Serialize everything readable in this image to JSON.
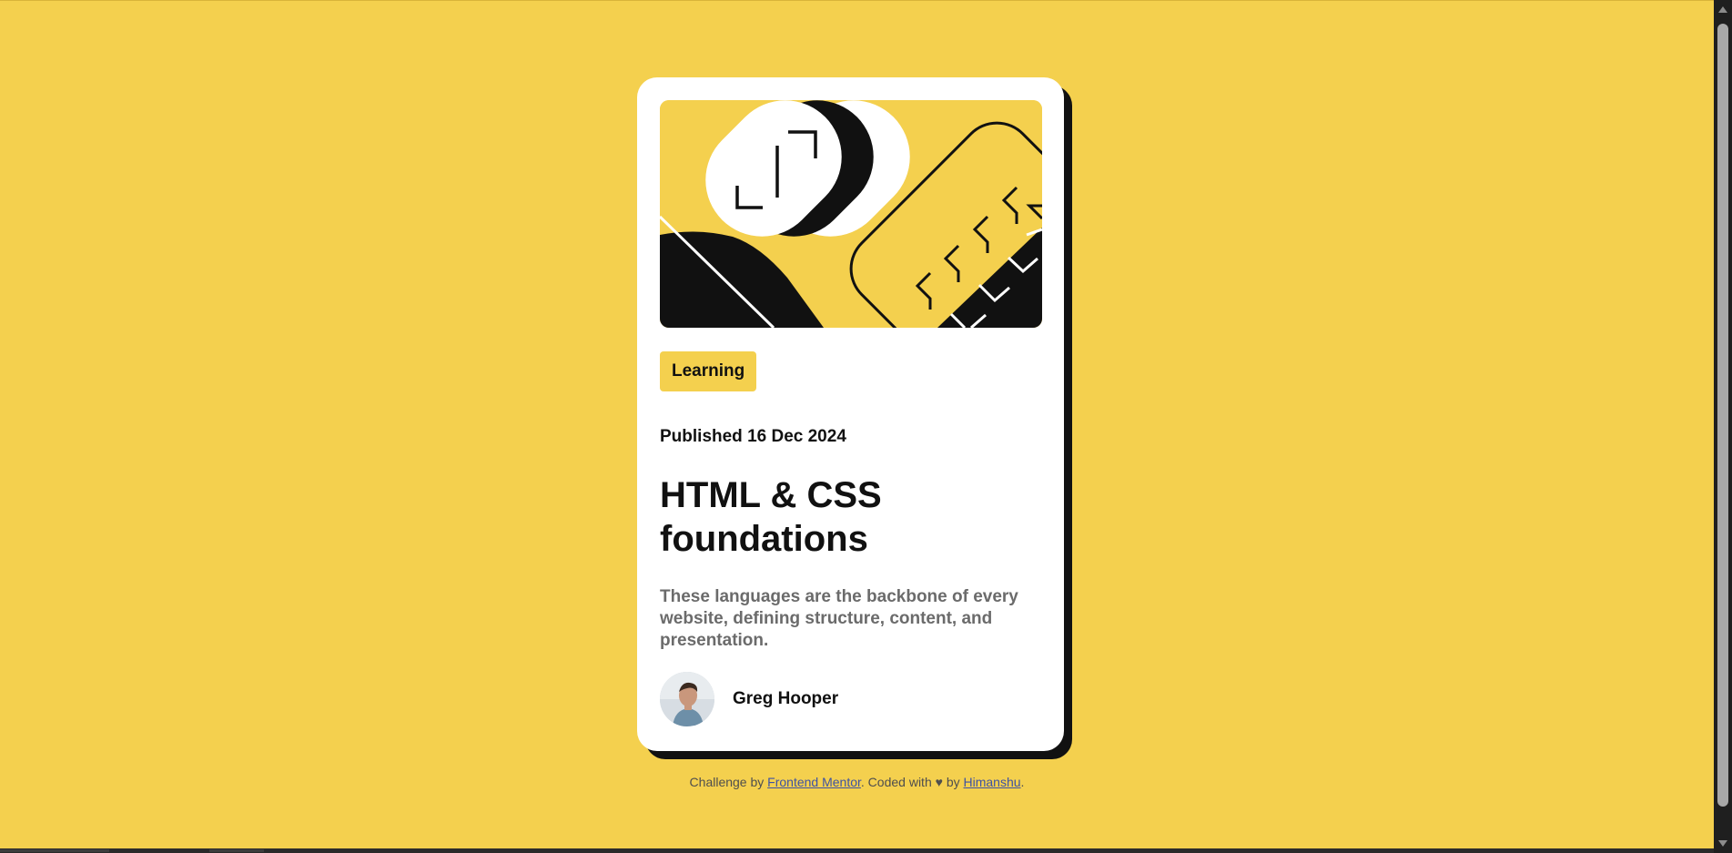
{
  "card": {
    "tag": "Learning",
    "published": "Published 16 Dec 2024",
    "title_line1": "HTML & CSS",
    "title_line2": "foundations",
    "description": "These languages are the backbone of every website, defining structure, content, and presentation.",
    "author_name": "Greg Hooper"
  },
  "footer": {
    "prefix": "Challenge by ",
    "link1": "Frontend Mentor",
    "middle": ". Coded with ",
    "heart": "♥",
    "by": " by ",
    "link2": "Himanshu",
    "suffix": "."
  },
  "colors": {
    "background": "#F4D04E",
    "card": "#FFFFFF",
    "text": "#111111",
    "muted": "#6B6B6B",
    "link": "#3E52A3"
  },
  "icons": {
    "hero": "illustration-article",
    "avatar": "avatar-photo",
    "heart": "heart-icon"
  }
}
